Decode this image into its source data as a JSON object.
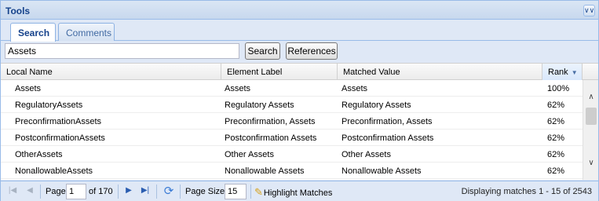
{
  "panel": {
    "title": "Tools",
    "collapse_icon": "double-chevron-down-icon"
  },
  "tabs": [
    {
      "label": "Search",
      "active": true
    },
    {
      "label": "Comments",
      "active": false
    }
  ],
  "search": {
    "value": "Assets",
    "button_label": "Search",
    "references_label": "References"
  },
  "grid": {
    "columns": [
      "Local Name",
      "Element Label",
      "Matched Value",
      "Rank"
    ],
    "sorted_column": "Rank",
    "rows": [
      {
        "local_name": "Assets",
        "element_label": "Assets",
        "matched_value": "Assets",
        "rank": "100%"
      },
      {
        "local_name": "RegulatoryAssets",
        "element_label": "Regulatory Assets",
        "matched_value": "Regulatory Assets",
        "rank": "62%"
      },
      {
        "local_name": "PreconfirmationAssets",
        "element_label": "Preconfirmation, Assets",
        "matched_value": "Preconfirmation, Assets",
        "rank": "62%"
      },
      {
        "local_name": "PostconfirmationAssets",
        "element_label": "Postconfirmation Assets",
        "matched_value": "Postconfirmation Assets",
        "rank": "62%"
      },
      {
        "local_name": "OtherAssets",
        "element_label": "Other Assets",
        "matched_value": "Other Assets",
        "rank": "62%"
      },
      {
        "local_name": "NonallowableAssets",
        "element_label": "Nonallowable Assets",
        "matched_value": "Nonallowable Assets",
        "rank": "62%"
      }
    ]
  },
  "pager": {
    "page_label": "Page",
    "page_value": "1",
    "of_label": "of 170",
    "page_size_label": "Page Size",
    "page_size_value": "15",
    "highlight_label": "Highlight Matches",
    "display_info": "Displaying matches 1 - 15 of 2543"
  }
}
